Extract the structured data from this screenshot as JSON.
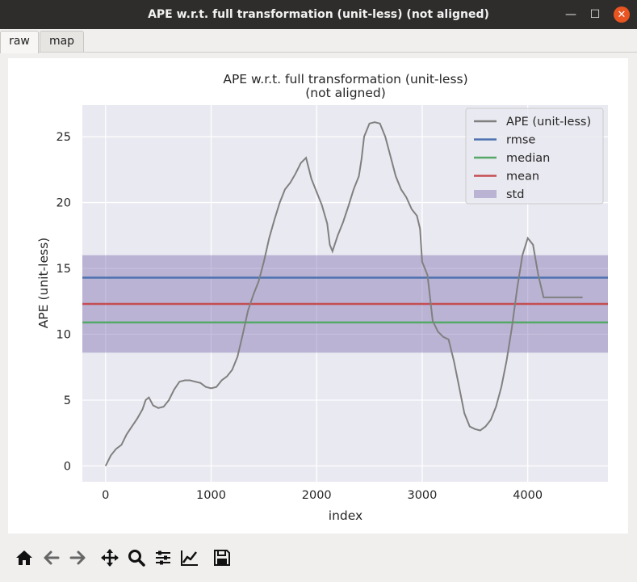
{
  "window": {
    "title": "APE w.r.t. full transformation (unit-less) (not aligned)",
    "minimize_glyph": "—",
    "maximize_glyph": "☐",
    "close_glyph": "✕"
  },
  "tabs": [
    {
      "label": "raw",
      "active": true
    },
    {
      "label": "map",
      "active": false
    }
  ],
  "colors": {
    "plot_bg": "#e9e9f1",
    "ape": "#808080",
    "rmse": "#4c72b0",
    "median": "#55a868",
    "mean": "#c44e52",
    "std_fill": "#8172b2"
  },
  "toolbar": [
    {
      "name": "home-icon"
    },
    {
      "name": "back-arrow-icon"
    },
    {
      "name": "forward-arrow-icon"
    },
    {
      "name": "pan-move-icon"
    },
    {
      "name": "zoom-magnifier-icon"
    },
    {
      "name": "configure-subplots-icon"
    },
    {
      "name": "edit-axis-curves-icon"
    },
    {
      "name": "save-figure-icon"
    }
  ],
  "chart_data": {
    "type": "line",
    "title": "APE w.r.t. full transformation (unit-less)",
    "subtitle": "(not aligned)",
    "xlabel": "index",
    "ylabel": "APE (unit-less)",
    "xlim": [
      -220,
      4760
    ],
    "ylim": [
      -1.2,
      27.4
    ],
    "xticks": [
      0,
      1000,
      2000,
      3000,
      4000
    ],
    "yticks": [
      0,
      5,
      10,
      15,
      20,
      25
    ],
    "legend_position": "top-right",
    "legend": [
      "APE (unit-less)",
      "rmse",
      "median",
      "mean",
      "std"
    ],
    "series": [
      {
        "name": "APE (unit-less)",
        "x": [
          0,
          50,
          100,
          150,
          200,
          250,
          300,
          350,
          380,
          410,
          450,
          500,
          550,
          600,
          650,
          700,
          750,
          800,
          850,
          900,
          950,
          1000,
          1050,
          1100,
          1150,
          1200,
          1250,
          1300,
          1350,
          1400,
          1450,
          1500,
          1550,
          1600,
          1650,
          1700,
          1750,
          1800,
          1850,
          1900,
          1950,
          2000,
          2050,
          2100,
          2125,
          2150,
          2200,
          2250,
          2300,
          2350,
          2400,
          2425,
          2450,
          2500,
          2550,
          2600,
          2650,
          2700,
          2750,
          2800,
          2850,
          2900,
          2950,
          2980,
          3000,
          3050,
          3100,
          3150,
          3200,
          3250,
          3300,
          3350,
          3400,
          3450,
          3500,
          3550,
          3600,
          3650,
          3700,
          3750,
          3800,
          3850,
          3900,
          3950,
          4000,
          4050,
          4100,
          4150,
          4200,
          4250,
          4300,
          4350,
          4400,
          4450,
          4500,
          4550
        ],
        "y": [
          0.0,
          0.8,
          1.3,
          1.6,
          2.4,
          3.0,
          3.6,
          4.3,
          5.0,
          5.2,
          4.6,
          4.4,
          4.5,
          5.0,
          5.8,
          6.4,
          6.5,
          6.5,
          6.4,
          6.3,
          6.0,
          5.9,
          6.0,
          6.5,
          6.8,
          7.3,
          8.3,
          10.0,
          11.8,
          13.0,
          14.0,
          15.5,
          17.3,
          18.7,
          20.0,
          21.0,
          21.5,
          22.2,
          23.0,
          23.4,
          21.8,
          20.8,
          19.8,
          18.4,
          16.8,
          16.3,
          17.5,
          18.5,
          19.7,
          21.0,
          22.0,
          23.3,
          25.0,
          26.0,
          26.1,
          26.0,
          25.0,
          23.5,
          22.0,
          21.0,
          20.4,
          19.5,
          19.0,
          18.0,
          15.5,
          14.5,
          11.0,
          10.2,
          9.8,
          9.6,
          8.0,
          6.0,
          4.0,
          3.0,
          2.8,
          2.7,
          3.0,
          3.5,
          4.5,
          6.0,
          8.0,
          10.5,
          13.5,
          16.0,
          17.3,
          16.8,
          14.5,
          12.8,
          12.8,
          12.8,
          12.8,
          12.8,
          12.8,
          12.8,
          12.8,
          12.8
        ],
        "x_end": 4520
      }
    ],
    "rmse": 14.3,
    "median": 10.9,
    "mean": 12.3,
    "std": 3.7
  }
}
